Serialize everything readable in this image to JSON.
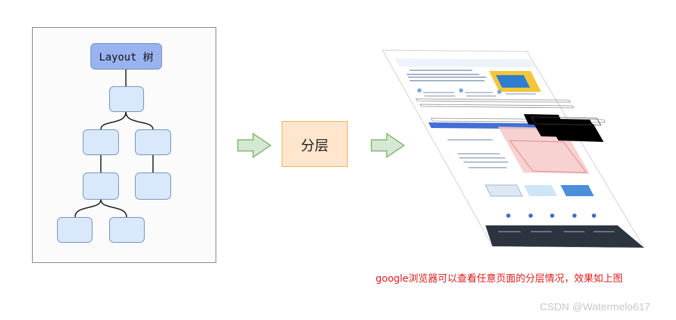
{
  "tree": {
    "root_label": "Layout 树"
  },
  "process": {
    "layer_label": "分层"
  },
  "caption": {
    "text": "google浏览器可以查看任意页面的分层情况，效果如上图"
  },
  "watermark": {
    "text": "CSDN @Watermelo617"
  },
  "colors": {
    "node_fill": "#dae8fc",
    "node_stroke": "#6c8ebf",
    "root_fill": "#99b3f0",
    "layer_fill": "#ffe6cc",
    "layer_stroke": "#f5b04c",
    "arrow_fill": "#d5e8d4",
    "arrow_stroke": "#82b366",
    "caption_color": "#e01b1b"
  }
}
